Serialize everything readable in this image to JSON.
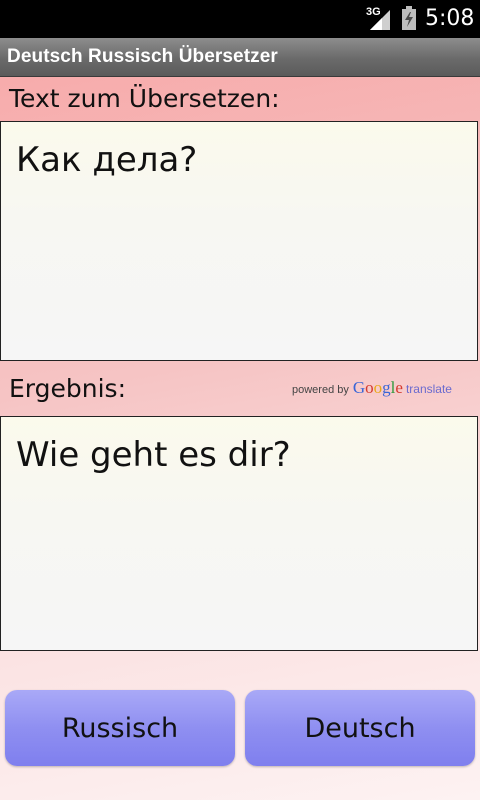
{
  "status": {
    "network": "3G",
    "time": "5:08"
  },
  "app": {
    "title": "Deutsch Russisch Übersetzer"
  },
  "input": {
    "label": "Text zum Übersetzen:",
    "value": "Как дела?"
  },
  "result": {
    "label": "Ergebnis:",
    "value": "Wie geht es dir?"
  },
  "attribution": {
    "powered_by": "powered by",
    "google": "Google",
    "translate": "translate"
  },
  "buttons": {
    "left_label": "Russisch",
    "right_label": "Deutsch"
  }
}
